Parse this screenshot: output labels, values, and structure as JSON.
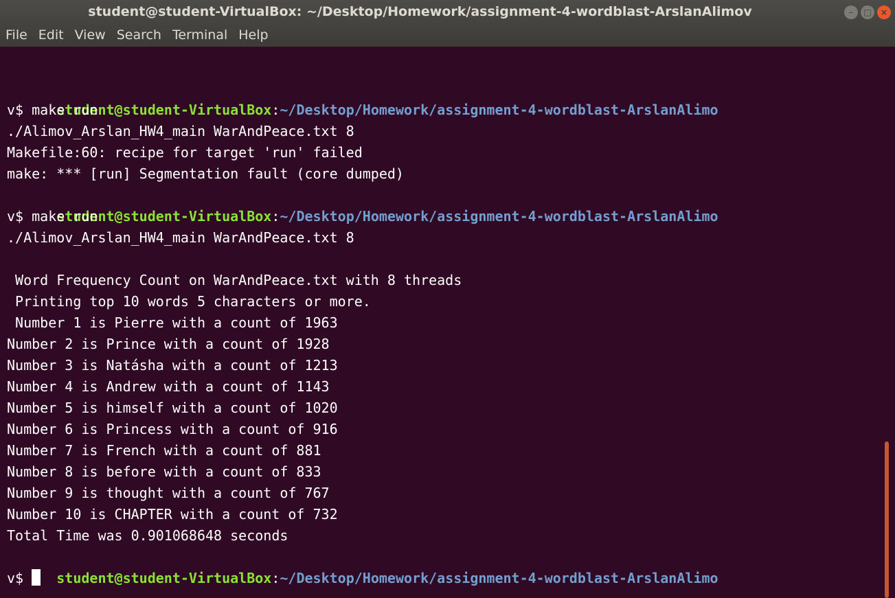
{
  "window": {
    "title": "student@student-VirtualBox: ~/Desktop/Homework/assignment-4-wordblast-ArslanAlimov",
    "minimize_glyph": "–",
    "maximize_glyph": "□",
    "close_glyph": "×"
  },
  "menu": [
    "File",
    "Edit",
    "View",
    "Search",
    "Terminal",
    "Help"
  ],
  "prompt": {
    "user_host": "student@student-VirtualBox",
    "colon": ":",
    "path": "~/Desktop/Homework/assignment-4-wordblast-ArslanAlimo",
    "wrap": "v$ "
  },
  "lines": [
    "make run",
    "./Alimov_Arslan_HW4_main WarAndPeace.txt 8",
    "Makefile:60: recipe for target 'run' failed",
    "make: *** [run] Segmentation fault (core dumped)",
    "make run",
    "./Alimov_Arslan_HW4_main WarAndPeace.txt 8",
    " Word Frequency Count on WarAndPeace.txt with 8 threads",
    " Printing top 10 words 5 characters or more.",
    " Number 1 is Pierre with a count of 1963",
    "Number 2 is Prince with a count of 1928",
    "Number 3 is Natásha with a count of 1213",
    "Number 4 is Andrew with a count of 1143",
    "Number 5 is himself with a count of 1020",
    "Number 6 is Princess with a count of 916",
    "Number 7 is French with a count of 881",
    "Number 8 is before with a count of 833",
    "Number 9 is thought with a count of 767",
    "Number 10 is CHAPTER with a count of 732",
    "Total Time was 0.901068648 seconds"
  ],
  "colors": {
    "background": "#300a24",
    "user_host": "#8ae234",
    "path": "#729fcf",
    "scrollbar": "#c5582f"
  }
}
